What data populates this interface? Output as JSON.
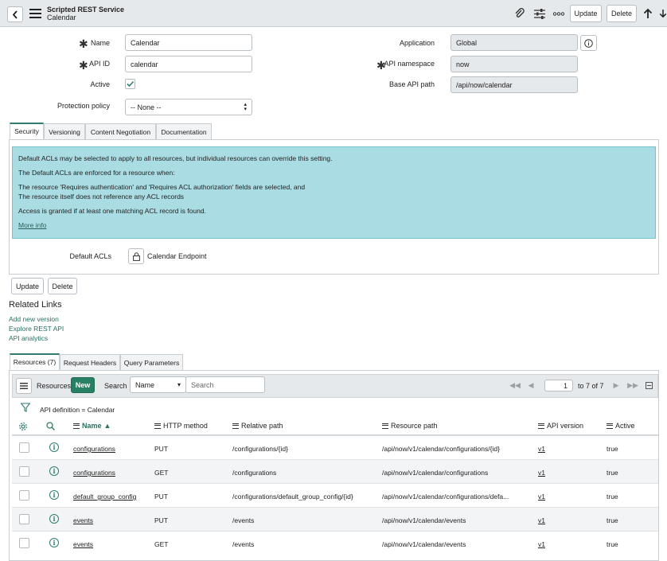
{
  "header": {
    "title": "Scripted REST Service",
    "subtitle": "Calendar",
    "update_label": "Update",
    "delete_label": "Delete"
  },
  "form": {
    "name_label": "Name",
    "name_value": "Calendar",
    "apiid_label": "API ID",
    "apiid_value": "calendar",
    "active_label": "Active",
    "active_checked": true,
    "protection_label": "Protection policy",
    "protection_value": "-- None --",
    "application_label": "Application",
    "application_value": "Global",
    "namespace_label": "API namespace",
    "namespace_value": "now",
    "basepath_label": "Base API path",
    "basepath_value": "/api/now/calendar"
  },
  "tabs": [
    "Security",
    "Versioning",
    "Content Negotiation",
    "Documentation"
  ],
  "info": {
    "line1": "Default ACLs may be selected to apply to all resources, but individual resources can override this setting.",
    "line2": "The Default ACLs are enforced for a resource when:",
    "line3": "The resource 'Requires authentication' and 'Requires ACL authorization' fields are selected, and",
    "line4": "The resource itself does not reference any ACL records",
    "line5": "Access is granted if at least one matching ACL record is found.",
    "more": "More info"
  },
  "default_acls": {
    "label": "Default ACLs",
    "value": "Calendar Endpoint"
  },
  "bottom_buttons": {
    "update": "Update",
    "delete": "Delete"
  },
  "related": {
    "title": "Related Links",
    "links": [
      "Add new version",
      "Explore REST API",
      "API analytics"
    ]
  },
  "related_tabs": [
    "Resources (7)",
    "Request Headers",
    "Query Parameters"
  ],
  "list": {
    "resources_label": "Resources",
    "new_label": "New",
    "search_label": "Search",
    "search_field": "Name",
    "search_placeholder": "Search",
    "page_value": "1",
    "page_total": "to 7 of 7",
    "filter_text": "API definition = Calendar",
    "columns": [
      "Name",
      "HTTP method",
      "Relative path",
      "Resource path",
      "API version",
      "Active"
    ],
    "rows": [
      {
        "name": "configurations",
        "method": "PUT",
        "relative": "/configurations/{id}",
        "resource": "/api/now/v1/calendar/configurations/{id}",
        "version": "v1",
        "active": "true"
      },
      {
        "name": "configurations",
        "method": "GET",
        "relative": "/configurations",
        "resource": "/api/now/v1/calendar/configurations",
        "version": "v1",
        "active": "true"
      },
      {
        "name": "default_group_config",
        "method": "PUT",
        "relative": "/configurations/default_group_config/{id}",
        "resource": "/api/now/v1/calendar/configurations/defa...",
        "version": "v1",
        "active": "true"
      },
      {
        "name": "events",
        "method": "PUT",
        "relative": "/events",
        "resource": "/api/now/v1/calendar/events",
        "version": "v1",
        "active": "true"
      },
      {
        "name": "events",
        "method": "GET",
        "relative": "/events",
        "resource": "/api/now/v1/calendar/events",
        "version": "v1",
        "active": "true"
      }
    ]
  },
  "colors": {
    "accent": "#2e7d6f",
    "new_button": "#288064",
    "info_bg": "#aadde3",
    "header_bg": "#e6e9eb"
  }
}
